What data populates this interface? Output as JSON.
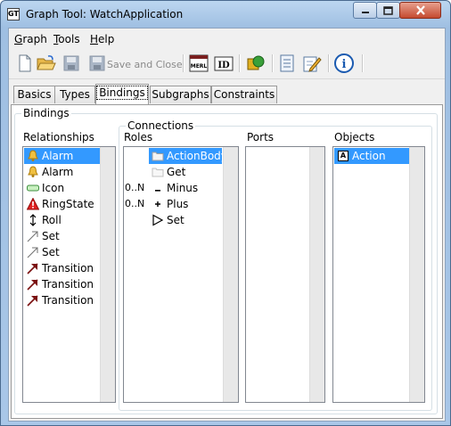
{
  "window": {
    "title": "Graph Tool: WatchApplication",
    "app_icon_text": "GT",
    "controls": {
      "minimize": "minimize-icon",
      "maximize": "maximize-icon",
      "close": "close-icon"
    }
  },
  "menubar": {
    "items": [
      {
        "first": "G",
        "rest": "raph"
      },
      {
        "first": "T",
        "rest": "ools"
      },
      {
        "first": "H",
        "rest": "elp"
      }
    ]
  },
  "toolbar": {
    "save_and_close_label": "Save and Close",
    "merl_label": "MERL",
    "id_label": "ID",
    "info_label": "i"
  },
  "tabs": [
    "Basics",
    "Types",
    "Bindings",
    "Subgraphs",
    "Constraints"
  ],
  "active_tab": "Bindings",
  "bindings": {
    "group_label": "Bindings",
    "relationships": {
      "label": "Relationships",
      "items": [
        {
          "icon": "bell-icon",
          "label": "Alarm",
          "selected": true
        },
        {
          "icon": "bell-icon",
          "label": "Alarm",
          "selected": false
        },
        {
          "icon": "icon-shape-icon",
          "label": "Icon",
          "selected": false
        },
        {
          "icon": "warning-icon",
          "label": "RingState",
          "selected": false
        },
        {
          "icon": "double-arrow-icon",
          "label": "Roll",
          "selected": false
        },
        {
          "icon": "arrow-icon",
          "label": "Set",
          "selected": false
        },
        {
          "icon": "arrow-icon",
          "label": "Set",
          "selected": false
        },
        {
          "icon": "transition-arrow-icon",
          "label": "Transition",
          "selected": false
        },
        {
          "icon": "transition-arrow-icon",
          "label": "Transition",
          "selected": false
        },
        {
          "icon": "transition-arrow-icon",
          "label": "Transition",
          "selected": false
        }
      ]
    },
    "connections": {
      "group_label": "Connections",
      "roles": {
        "label": "Roles",
        "items": [
          {
            "card": "",
            "icon": "folder-icon",
            "label": "ActionBody",
            "selected": true
          },
          {
            "card": "",
            "icon": "folder-icon",
            "label": "Get",
            "selected": false
          },
          {
            "card": "0..N",
            "icon": "minus-icon",
            "label": "Minus",
            "selected": false
          },
          {
            "card": "0..N",
            "icon": "plus-icon",
            "label": "Plus",
            "selected": false
          },
          {
            "card": "",
            "icon": "triangle-icon",
            "label": "Set",
            "selected": false
          }
        ]
      },
      "ports": {
        "label": "Ports",
        "items": []
      },
      "objects": {
        "label": "Objects",
        "items": [
          {
            "icon": "object-a-icon",
            "icon_text": "A",
            "label": "Action",
            "selected": true
          }
        ]
      }
    }
  }
}
